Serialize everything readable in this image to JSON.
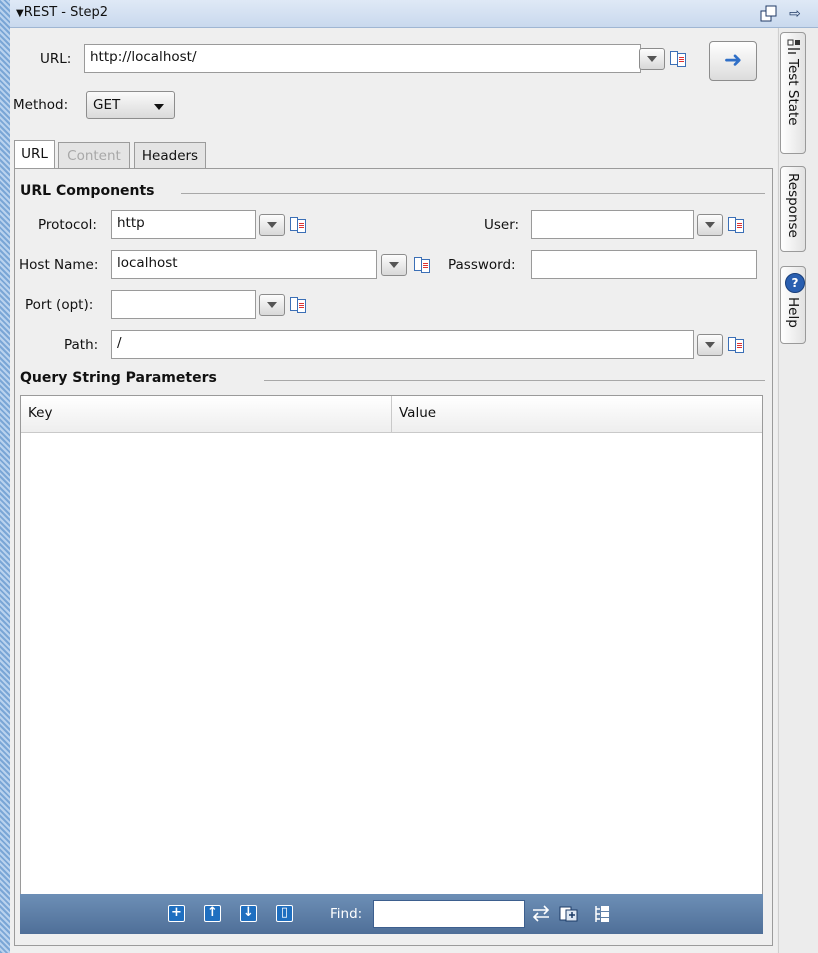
{
  "window": {
    "title": "REST - Step2"
  },
  "request": {
    "url_label": "URL:",
    "url_value": "http://localhost/",
    "method_label": "Method:",
    "method_value": "GET"
  },
  "tabs": [
    {
      "label": "URL",
      "state": "active"
    },
    {
      "label": "Content",
      "state": "disabled"
    },
    {
      "label": "Headers",
      "state": "normal"
    }
  ],
  "url_components": {
    "section_title": "URL Components",
    "protocol_label": "Protocol:",
    "protocol_value": "http",
    "user_label": "User:",
    "user_value": "",
    "host_label": "Host Name:",
    "host_value": "localhost",
    "password_label": "Password:",
    "password_value": "",
    "port_label": "Port (opt):",
    "port_value": "",
    "path_label": "Path:",
    "path_value": "/"
  },
  "query_params": {
    "section_title": "Query String Parameters",
    "columns": [
      "Key",
      "Value"
    ],
    "rows": []
  },
  "bottom_toolbar": {
    "find_label": "Find:",
    "find_value": ""
  },
  "right_panel": {
    "tabs": [
      "Test State",
      "Response",
      "Help"
    ]
  },
  "icons": {
    "collapse": "triangle-down-icon",
    "float": "float-window-icon",
    "pin": "arrow-right-icon",
    "go": "go-arrow-icon",
    "parameterize": "parameterize-icon",
    "add": "plus-icon",
    "up": "arrow-up-icon",
    "down": "arrow-down-icon",
    "delete": "trash-icon"
  },
  "colors": {
    "accent": "#2f6fc7",
    "toolbar": "#5b7ba4"
  }
}
